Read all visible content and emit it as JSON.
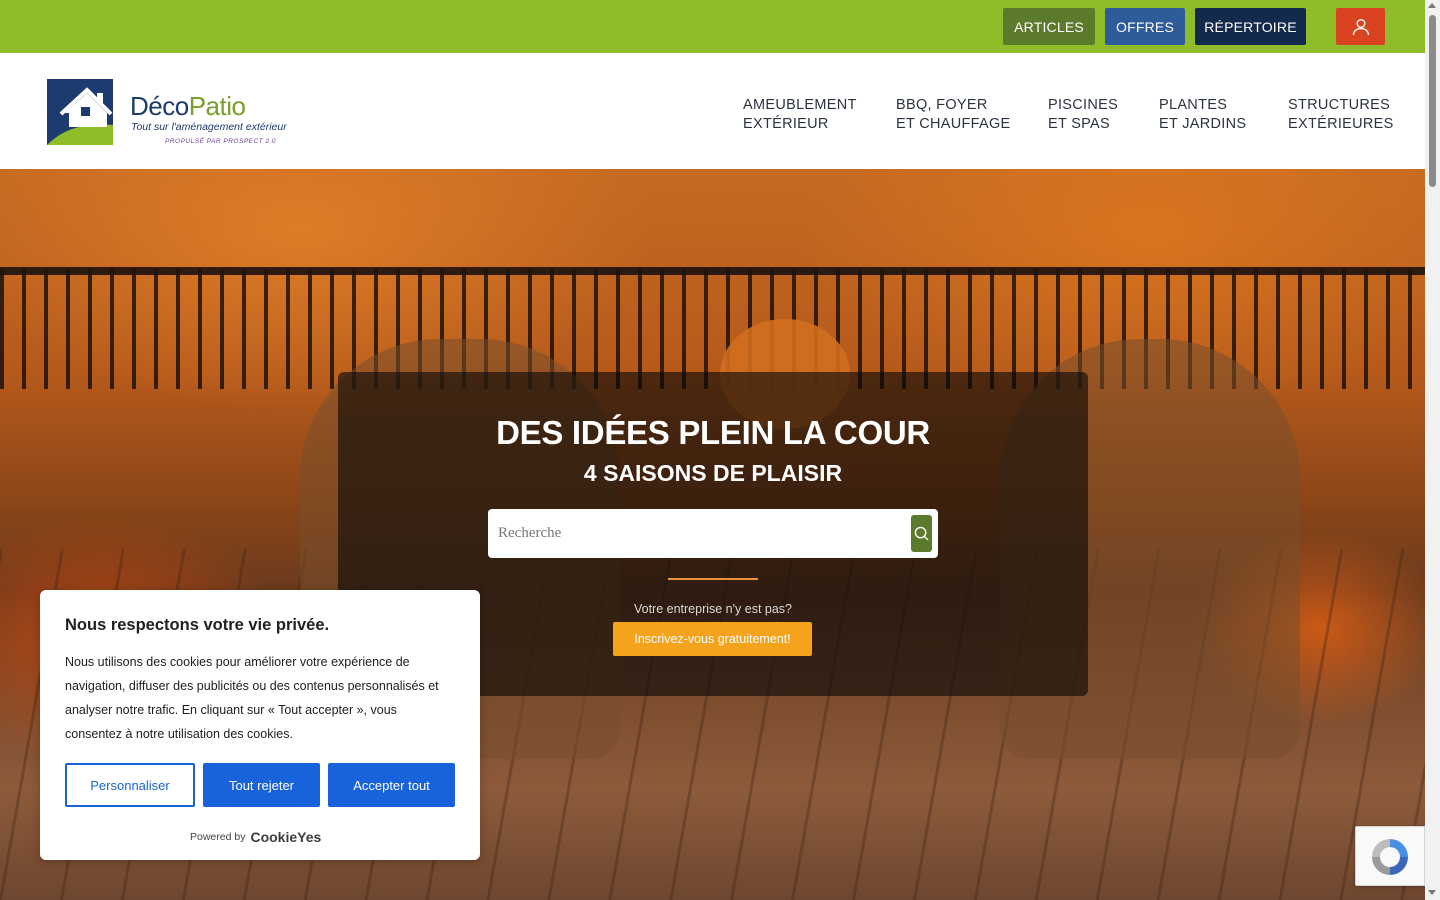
{
  "topbar": {
    "articles": "ARTICLES",
    "offres": "OFFRES",
    "repertoire": "RÉPERTOIRE",
    "user_icon": "user-icon"
  },
  "logo": {
    "brand_part1": "Déco",
    "brand_part2": "Patio",
    "tagline": "Tout sur l'aménagement extérieur",
    "powered": "PROPULSÉ PAR PROSPECT 2.0"
  },
  "nav": [
    {
      "line1": "AMEUBLEMENT",
      "line2": "EXTÉRIEUR"
    },
    {
      "line1": "BBQ, FOYER",
      "line2": "ET CHAUFFAGE"
    },
    {
      "line1": "PISCINES",
      "line2": "ET SPAS"
    },
    {
      "line1": "PLANTES",
      "line2": "ET JARDINS"
    },
    {
      "line1": "STRUCTURES",
      "line2": "EXTÉRIEURES"
    }
  ],
  "hero": {
    "title": "DES IDÉES PLEIN LA COUR",
    "subtitle": "4 SAISONS DE PLAISIR",
    "search_placeholder": "Recherche",
    "prompt": "Votre entreprise n'y est pas?",
    "signup": "Inscrivez-vous gratuitement!"
  },
  "cookie": {
    "title": "Nous respectons votre vie privée.",
    "text": "Nous utilisons des cookies pour améliorer votre expérience de navigation, diffuser des publicités ou des contenus personnalisés et analyser notre trafic. En cliquant sur « Tout accepter », vous consentez à notre utilisation des cookies.",
    "customize": "Personnaliser",
    "reject": "Tout rejeter",
    "accept": "Accepter tout",
    "powered_by": "Powered by",
    "powered_brand": "CookieYes"
  },
  "colors": {
    "topbar": "#8fbd2a",
    "articles": "#5c7a2c",
    "offres": "#2e5b9a",
    "repertoire": "#142a4d",
    "user": "#d9431f",
    "signup": "#f5a21c",
    "cookie_accent": "#1863dc"
  }
}
